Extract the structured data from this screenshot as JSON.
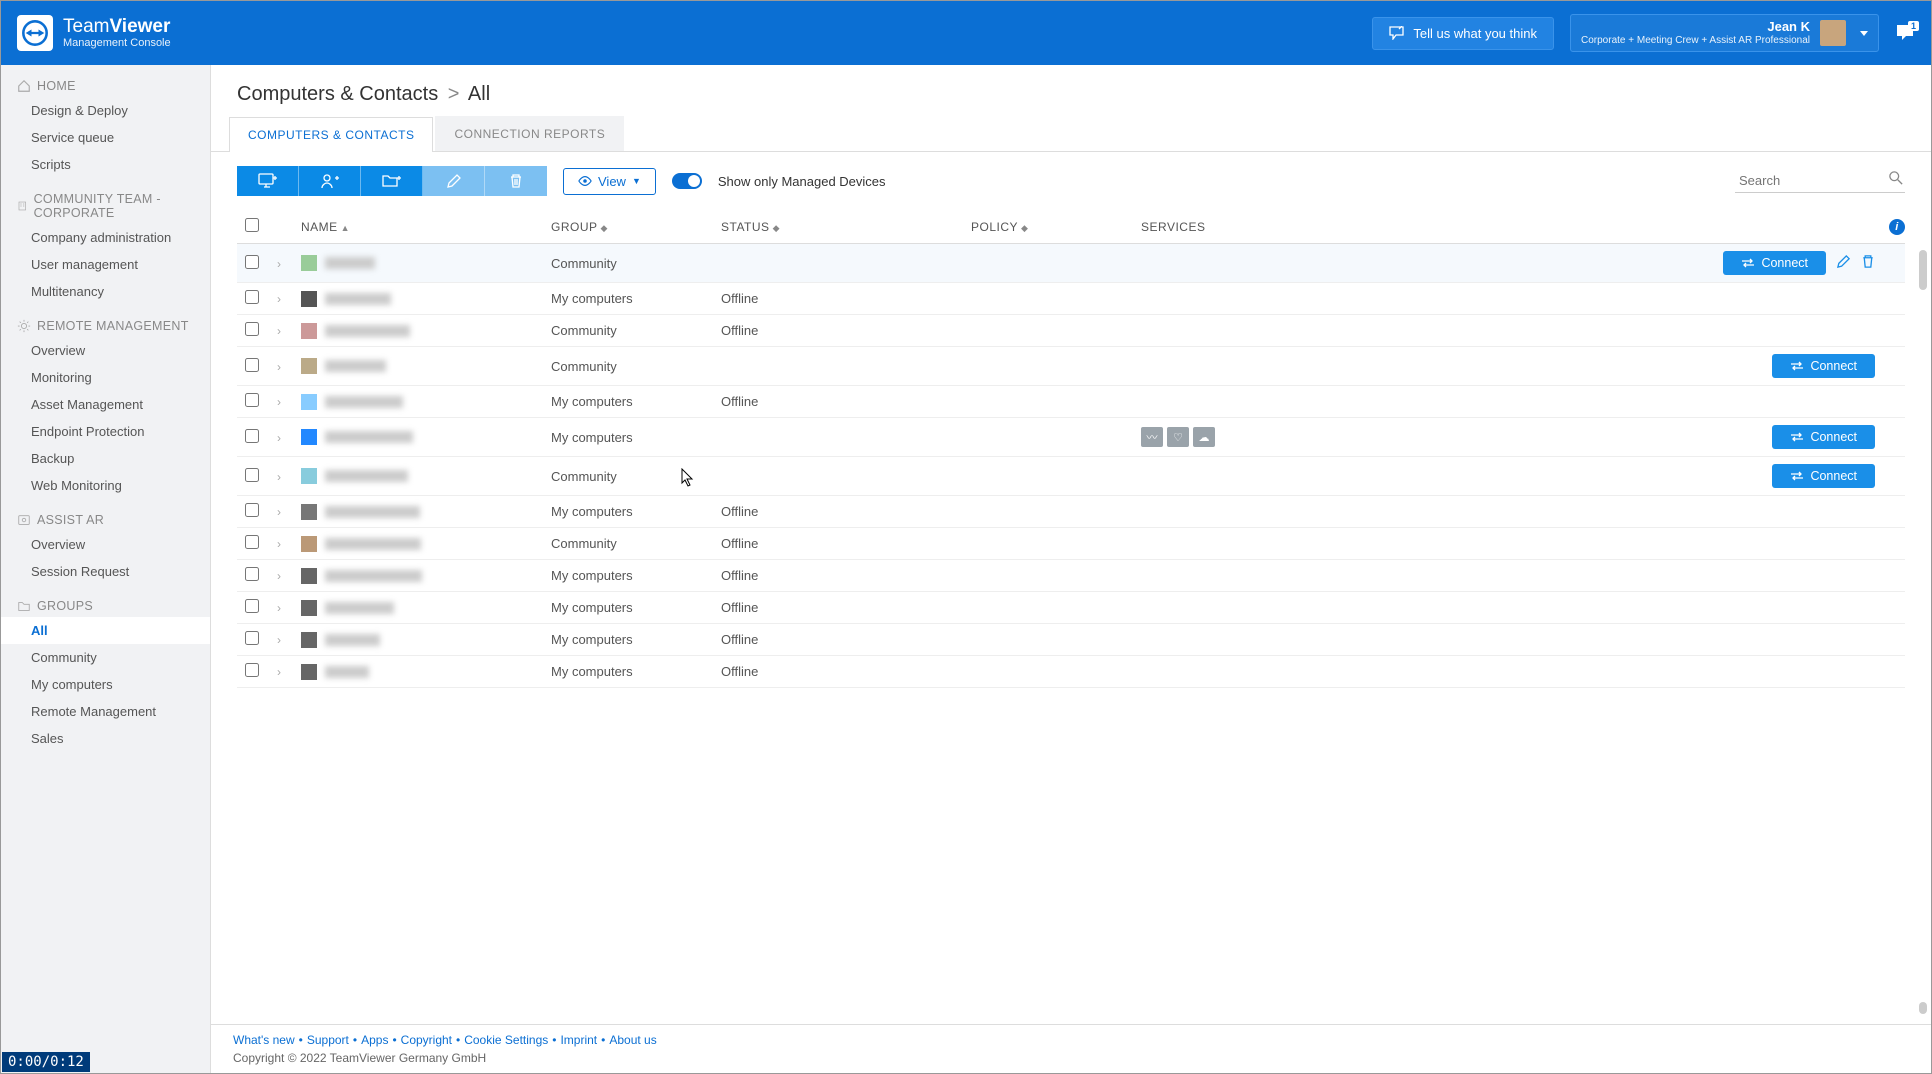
{
  "header": {
    "brand_prefix": "Team",
    "brand_suffix": "Viewer",
    "subtitle": "Management Console",
    "feedback_label": "Tell us what you think",
    "account_name": "Jean K",
    "account_plan": "Corporate + Meeting Crew + Assist AR Professional",
    "notification_count": "1"
  },
  "sidebar": {
    "home": {
      "label": "HOME",
      "items": [
        "Design & Deploy",
        "Service queue",
        "Scripts"
      ]
    },
    "community": {
      "label": "COMMUNITY TEAM - CORPORATE",
      "items": [
        "Company administration",
        "User management",
        "Multitenancy"
      ]
    },
    "remote": {
      "label": "REMOTE MANAGEMENT",
      "items": [
        "Overview",
        "Monitoring",
        "Asset Management",
        "Endpoint Protection",
        "Backup",
        "Web Monitoring"
      ]
    },
    "assist": {
      "label": "ASSIST AR",
      "items": [
        "Overview",
        "Session Request"
      ]
    },
    "groups": {
      "label": "GROUPS",
      "items": [
        "All",
        "Community",
        "My computers",
        "Remote Management",
        "Sales"
      ]
    }
  },
  "breadcrumb": {
    "root": "Computers & Contacts",
    "sep": ">",
    "leaf": "All"
  },
  "tabs": {
    "t0": "COMPUTERS & CONTACTS",
    "t1": "CONNECTION REPORTS"
  },
  "toolbar": {
    "view_label": "View",
    "toggle_label": "Show only Managed Devices",
    "search_placeholder": "Search"
  },
  "columns": {
    "name": "NAME",
    "group": "GROUP",
    "status": "STATUS",
    "policy": "POLICY",
    "services": "SERVICES"
  },
  "connect_label": "Connect",
  "rows": [
    {
      "group": "Community",
      "status": "",
      "connect": true,
      "hovered": true,
      "editdel": true
    },
    {
      "group": "My computers",
      "status": "Offline"
    },
    {
      "group": "Community",
      "status": "Offline"
    },
    {
      "group": "Community",
      "status": "",
      "connect": true
    },
    {
      "group": "My computers",
      "status": "Offline"
    },
    {
      "group": "My computers",
      "status": "",
      "connect": true,
      "services": true
    },
    {
      "group": "Community",
      "status": "",
      "connect": true
    },
    {
      "group": "My computers",
      "status": "Offline"
    },
    {
      "group": "Community",
      "status": "Offline"
    },
    {
      "group": "My computers",
      "status": "Offline"
    },
    {
      "group": "My computers",
      "status": "Offline"
    },
    {
      "group": "My computers",
      "status": "Offline"
    },
    {
      "group": "My computers",
      "status": "Offline"
    }
  ],
  "footer": {
    "links": [
      "What's new",
      "Support",
      "Apps",
      "Copyright",
      "Cookie Settings",
      "Imprint",
      "About us"
    ],
    "copyright": "Copyright © 2022 TeamViewer Germany GmbH"
  },
  "timestamp": "0:00/0:12"
}
